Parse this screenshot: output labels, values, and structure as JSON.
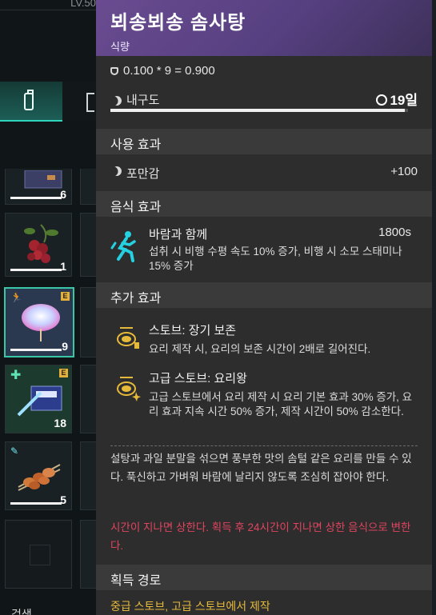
{
  "inventory": {
    "level_label": "LV.50",
    "slots": [
      {
        "count": "6"
      },
      {
        "count": "1"
      },
      {
        "count": "9",
        "badge": "E"
      },
      {
        "count": "18",
        "badge": "E"
      },
      {
        "count": "5"
      }
    ],
    "search_label": "검색"
  },
  "item": {
    "name": "뵈송뵈송 솜사탕",
    "type": "식량",
    "weight_formula": "0.100 * 9 = 0.900",
    "durability_label": "내구도",
    "durability_value": "19일",
    "durability_fill": 0.99
  },
  "sections": {
    "use_effect": "사용 효과",
    "food_effect": "음식 효과",
    "extra_effect": "추가 효과",
    "acquire": "획득 경로"
  },
  "use_effect": {
    "label": "포만감",
    "value": "+100"
  },
  "food_effect": {
    "name": "바람과 함께",
    "duration": "1800s",
    "desc": "섭취 시 비행 수평 속도 10% 증가, 비행 시 소모 스태미나 15% 증가"
  },
  "extra_effects": [
    {
      "name": "스토브: 장기 보존",
      "desc": "요리 제작 시, 요리의 보존 시간이 2배로 길어진다."
    },
    {
      "name": "고급 스토브: 요리왕",
      "desc": "고급 스토브에서 요리 제작 시 요리 기본 효과 30% 증가, 요리 효과 지속 시간 50% 증가, 제작 시간이 50% 감소한다."
    }
  ],
  "description": "설탕과 과일 분말을 섞으면 풍부한 맛의 솜털 같은 요리를 만들 수 있다. 푹신하고 가벼워 바람에 날리지 않도록 조심히 잡아야 한다.",
  "warning": "시간이 지나면 상한다. 획득 후 24시간이 지나면 상한 음식으로 변한다.",
  "acquire_source": "중급 스토브, 고급 스토브에서 제작",
  "colors": {
    "header": "#6a4b91",
    "accent": "#2fd6bd",
    "warning": "#e0445f",
    "source": "#e5b93a"
  }
}
